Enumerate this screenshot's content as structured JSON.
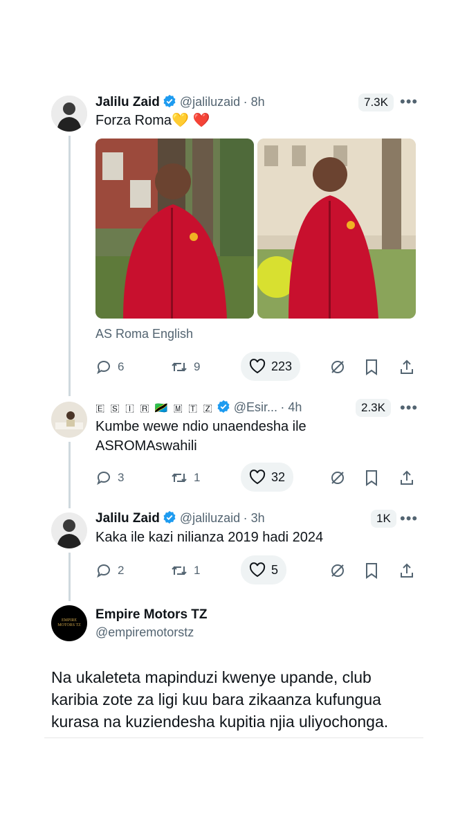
{
  "tweet1": {
    "name": "Jalilu Zaid",
    "handle": "@jaliluzaid",
    "time": "· 8h",
    "views": "7.3K",
    "text": "Forza Roma💛 ❤️",
    "source": "AS Roma English",
    "replies": "6",
    "retweets": "9",
    "likes": "223"
  },
  "tweet2": {
    "name": "🇪 🇸 🇮 🇷 🇹🇿 🇲 🇹 🇿",
    "handle": "@Esir...",
    "time": "· 4h",
    "views": "2.3K",
    "text_line1": "Kumbe wewe ndio unaendesha ile",
    "text_line2": "ASROMAswahili",
    "replies": "3",
    "retweets": "1",
    "likes": "32"
  },
  "tweet3": {
    "name": "Jalilu Zaid",
    "handle": "@jaliluzaid",
    "time": "· 3h",
    "views": "1K",
    "text": "Kaka ile kazi nilianza 2019 hadi 2024",
    "replies": "2",
    "retweets": "1",
    "likes": "5"
  },
  "caption": {
    "name": "Empire Motors TZ",
    "handle": "@empiremotorstz",
    "avatar_text": "EMPIRE MOTORS TZ",
    "line1": "Na ukaleteta mapinduzi kwenye upande, club",
    "line2": "karibia zote za ligi kuu bara zikaanza kufungua",
    "line3": "kurasa na kuziendesha kupitia njia uliyochonga."
  },
  "colors": {
    "verified": "#1d9bf0",
    "roma_red": "#c8102e",
    "text": "#0f1419",
    "muted": "#536471"
  },
  "icons": [
    "reply-icon",
    "retweet-icon",
    "heart-icon",
    "grok-icon",
    "bookmark-icon",
    "share-icon",
    "verified-icon",
    "more-icon"
  ]
}
